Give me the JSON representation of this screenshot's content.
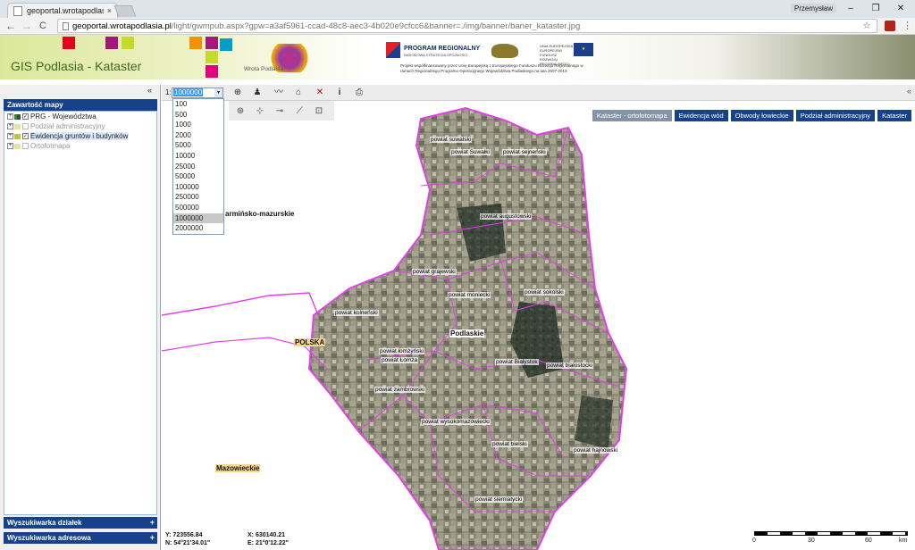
{
  "browser": {
    "tab_title": "geoportal.wrotapodlasia",
    "tab_close": "×",
    "profile_name": "Przemysław",
    "url_host": "geoportal.wrotapodlasia.pl",
    "url_rest": "/light/gwmpub.aspx?gpw=a3af5961-ccad-48c8-aec3-4b020e9cfcc6&banner=./img/banner/baner_kataster.jpg",
    "back": "←",
    "forward": "→",
    "reload": "C",
    "star": "☆",
    "menu": "⋮",
    "minimize": "–",
    "restore": "❐",
    "close": "✕"
  },
  "banner": {
    "title": "GIS Podlasia - Kataster",
    "wrota_label": "Wrota Podlasia",
    "program_title": "PROGRAM REGIONALNY",
    "program_sub": "NARODOWA STRATEGIA SPÓJNOŚCI",
    "ue_text": "UNIA EUROPEJSKA EUROPEJSKI FUNDUSZ ROZWOJU REGIONALNEGO",
    "footer_text": "Projekt współfinansowany przez Unię Europejską z Europejskiego Funduszu Rozwoju Regionalnego w ramach Regionalnego Programu Operacyjnego Województwa Podlaskiego na lata 2007-2013"
  },
  "left_panel": {
    "collapse": "«",
    "header_map_contents": "Zawartość mapy",
    "header_parcel_search": "Wyszukiwarka działek",
    "header_address_search": "Wyszukiwarka adresowa",
    "header_plus": "+",
    "tree": [
      {
        "label": "PRG - Województwa",
        "checked": true
      },
      {
        "label": "Podział administracyjny",
        "checked": false
      },
      {
        "label": "Ewidencja gruntów i budynków",
        "checked": true
      },
      {
        "label": "Ortofotmapa",
        "checked": false
      }
    ],
    "check_mark": "✓",
    "expand_mark": "+"
  },
  "map": {
    "scale_prefix": "1:",
    "scale_value": "1000000",
    "scale_arrow": "▾",
    "scale_options": [
      "100",
      "500",
      "1000",
      "2000",
      "5000",
      "10000",
      "25000",
      "50000",
      "100000",
      "250000",
      "500000",
      "1000000",
      "2000000"
    ],
    "collapse_right": "«",
    "layer_tabs": [
      {
        "label": "Kataster - ortofotomapa",
        "active": true
      },
      {
        "label": "Ewidencja wód",
        "active": false
      },
      {
        "label": "Obwody łowieckie",
        "active": false
      },
      {
        "label": "Podział administracyjny",
        "active": false
      },
      {
        "label": "Kataster",
        "active": false
      }
    ],
    "regions": {
      "warminsko": "armińsko-mazurskie",
      "polska": "POLSKA",
      "mazowieckie": "Mazowieckie",
      "podlaskie": "Podlaskie"
    },
    "districts": {
      "suwalski": "powiat suwalski",
      "suwalki": "powiat Suwałki",
      "sejnenski": "powiat sejneński",
      "augustowski": "powiat augustowski",
      "grajewski": "powiat grajewski",
      "moniecki": "powiat moniecki",
      "sokolski": "powiat sokólski",
      "kolnenski": "powiat kolneński",
      "lomzynski": "powiat łomżyński",
      "lomza": "powiat Łomża",
      "bialystok": "powiat Białystok",
      "bialostocki": "powiat białostocki",
      "zambrowski": "powiat zambrowski",
      "wysokomazowiecki": "powiat wysokomazowiecki",
      "bielski": "powiat bielski",
      "hajnowski": "powiat hajnowski",
      "siemiatycki": "powiat siemiatycki"
    },
    "coords": {
      "y": "Y: 723556.84",
      "x": "X: 630140.21",
      "n": "N: 54°21'34.01\"",
      "e": "E: 21°0'12.22\""
    },
    "scalebar": {
      "l0": "0",
      "l30": "30",
      "l60": "60",
      "unit": "km"
    },
    "colors": {
      "boundary": "#e040e8",
      "header_blue": "#15428b"
    }
  }
}
